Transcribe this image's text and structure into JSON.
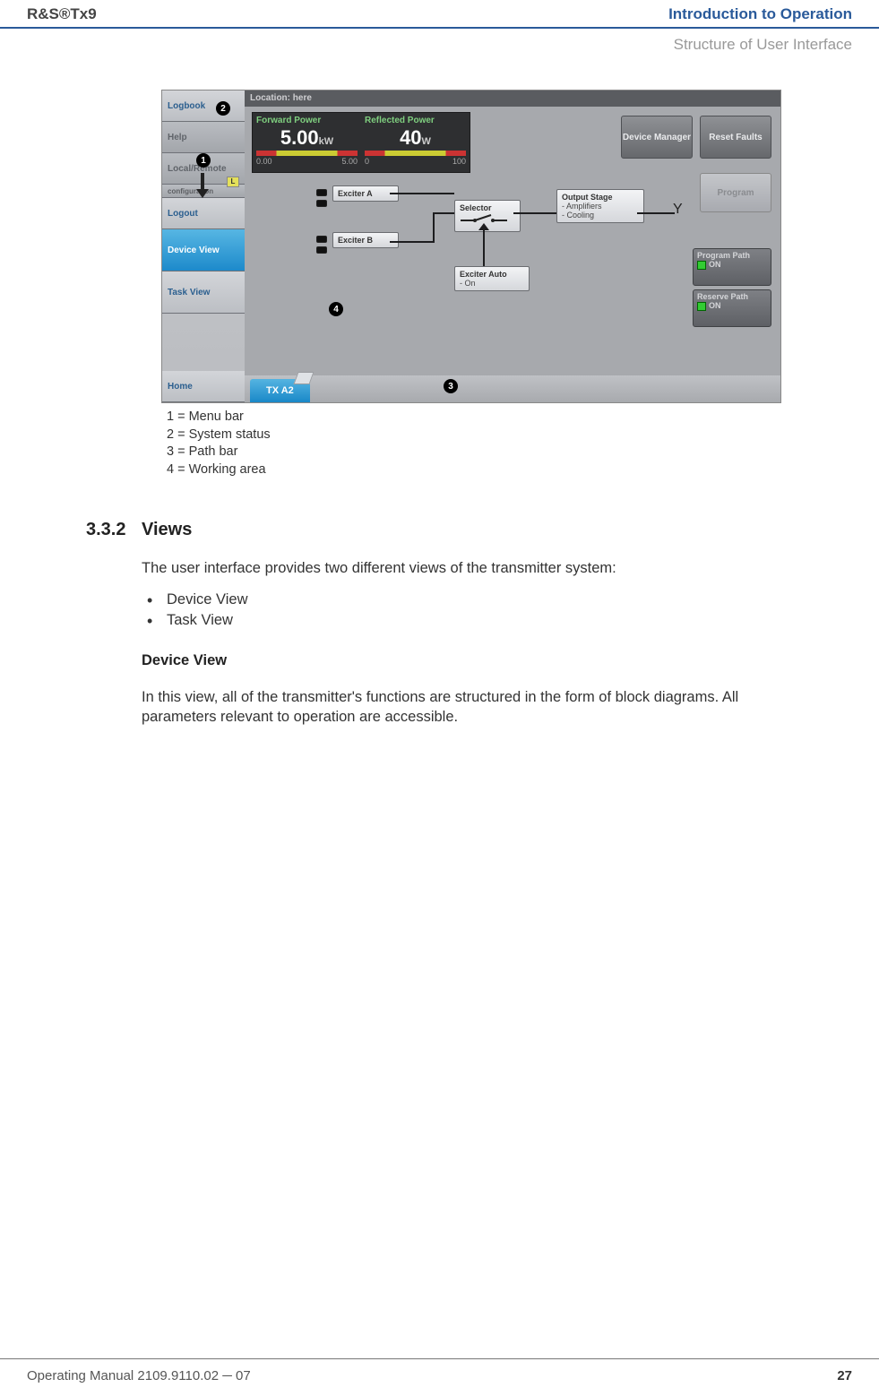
{
  "header": {
    "left": "R&S®Tx9",
    "right": "Introduction to Operation",
    "sub": "Structure of User Interface"
  },
  "ui": {
    "menubar": {
      "logbook": "Logbook",
      "help": "Help",
      "localremote": "Local/Remote",
      "configuration": "configuration",
      "logout": "Logout",
      "deviceview": "Device View",
      "taskview": "Task View",
      "home": "Home"
    },
    "titlebar": "Location: here",
    "meters": {
      "fwd": {
        "title": "Forward Power",
        "value": "5.00",
        "unit": "kW",
        "min": "0.00",
        "max": "5.00"
      },
      "ref": {
        "title": "Reflected Power",
        "value": "40",
        "unit": "W",
        "min": "0",
        "max": "100"
      }
    },
    "buttons": {
      "devmgr": "Device\nManager",
      "reset": "Reset Faults",
      "program": "Program"
    },
    "nodes": {
      "exA": "Exciter A",
      "exB": "Exciter B",
      "sel": "Selector",
      "out": {
        "title": "Output Stage",
        "l1": "- Amplifiers",
        "l2": "- Cooling"
      },
      "auto": {
        "title": "Exciter Auto",
        "l1": "- On"
      }
    },
    "right": {
      "prog": {
        "title": "Program Path",
        "state": "ON"
      },
      "res": {
        "title": "Reserve Path",
        "state": "ON"
      }
    },
    "pathbar": {
      "tab": "TX A2"
    },
    "badge_L": "L"
  },
  "callouts": {
    "c1": "1",
    "c2": "2",
    "c3": "3",
    "c4": "4"
  },
  "legend": {
    "l1": "1 = Menu bar",
    "l2": "2 = System status",
    "l3": "3 = Path bar",
    "l4": "4 = Working area"
  },
  "section": {
    "num": "3.3.2",
    "title": "Views",
    "intro": "The user interface provides two different views of the transmitter system:",
    "b1": "Device View",
    "b2": "Task View",
    "sub": "Device View",
    "p2": "In this view, all of the transmitter's functions are structured in the form of block diagrams. All parameters relevant to operation are accessible."
  },
  "footer": {
    "left": "Operating Manual 2109.9110.02 ─ 07",
    "page": "27"
  }
}
